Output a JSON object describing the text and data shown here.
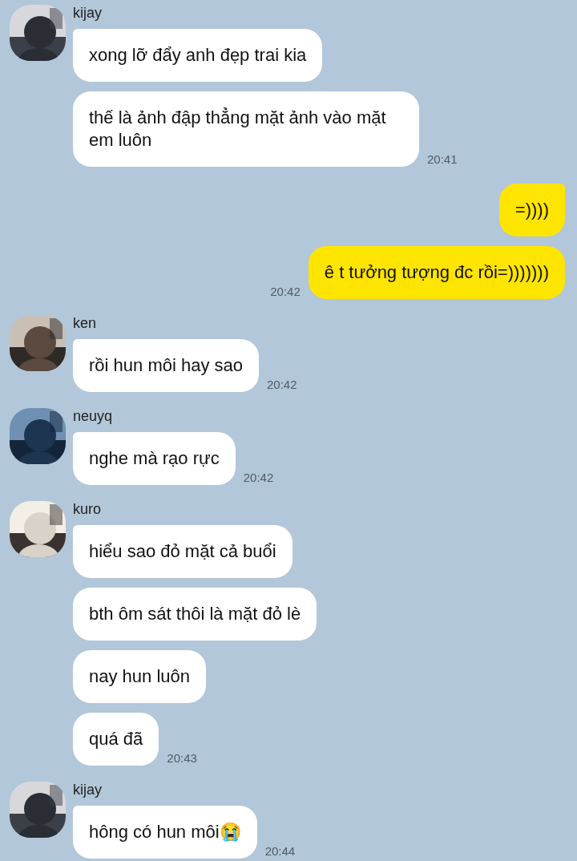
{
  "messages": [
    {
      "kind": "incoming",
      "sender": "kijay",
      "bubbles": [
        {
          "text": "xong lỡ đẩy anh đẹp trai kia"
        },
        {
          "text": "thế là ảnh đập thẳng mặt ảnh vào mặt em luôn",
          "time": "20:41"
        }
      ]
    },
    {
      "kind": "outgoing",
      "bubbles": [
        {
          "text": "=))))"
        },
        {
          "text": "ê t tưởng tượng đc rồi=)))))))",
          "time": "20:42"
        }
      ]
    },
    {
      "kind": "incoming",
      "sender": "ken",
      "bubbles": [
        {
          "text": "rồi hun môi hay sao",
          "time": "20:42"
        }
      ]
    },
    {
      "kind": "incoming",
      "sender": "neuyq",
      "bubbles": [
        {
          "text": "nghe mà rạo rực",
          "time": "20:42"
        }
      ]
    },
    {
      "kind": "incoming",
      "sender": "kuro",
      "bubbles": [
        {
          "text": "hiểu sao đỏ mặt cả buổi"
        },
        {
          "text": "bth ôm sát thôi là mặt đỏ lè"
        },
        {
          "text": "nay hun luôn"
        },
        {
          "text": "quá đã",
          "time": "20:43"
        }
      ]
    },
    {
      "kind": "incoming",
      "sender": "kijay",
      "bubbles": [
        {
          "text": "hông có hun môi😭",
          "time": "20:44"
        }
      ]
    }
  ]
}
